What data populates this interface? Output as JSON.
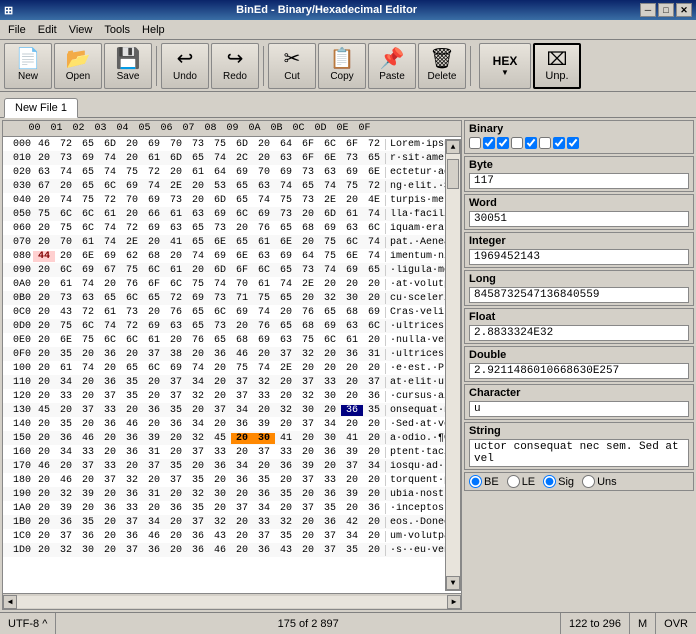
{
  "titlebar": {
    "title": "BinEd - Binary/Hexadecimal Editor",
    "icon": "⬛",
    "min_btn": "─",
    "max_btn": "□",
    "close_btn": "✕"
  },
  "menu": {
    "items": [
      "File",
      "Edit",
      "View",
      "Tools",
      "Help"
    ]
  },
  "toolbar": {
    "buttons": [
      {
        "id": "new",
        "label": "New",
        "icon": "📄"
      },
      {
        "id": "open",
        "label": "Open",
        "icon": "📂"
      },
      {
        "id": "save",
        "label": "Save",
        "icon": "💾"
      },
      {
        "id": "undo",
        "label": "Undo",
        "icon": "↩"
      },
      {
        "id": "redo",
        "label": "Redo",
        "icon": "↪"
      },
      {
        "id": "cut",
        "label": "Cut",
        "icon": "✂"
      },
      {
        "id": "copy",
        "label": "Copy",
        "icon": "📋"
      },
      {
        "id": "paste",
        "label": "Paste",
        "icon": "📌"
      },
      {
        "id": "delete",
        "label": "Delete",
        "icon": "🗑"
      }
    ],
    "hex_btn": "HEX",
    "unp_btn": "Unp."
  },
  "tab": {
    "label": "New File 1"
  },
  "hex_header": {
    "addr": "",
    "cols": [
      "00",
      "01",
      "02",
      "03",
      "04",
      "05",
      "06",
      "07",
      "08",
      "09",
      "0A",
      "0B",
      "0C",
      "0D",
      "0E",
      "0F"
    ]
  },
  "hex_rows": [
    {
      "addr": "000",
      "bytes": [
        "46",
        "72",
        "65",
        "6D",
        "20",
        "69",
        "70",
        "73",
        "75",
        "6D",
        "20",
        "64",
        "6F",
        "6C",
        "6F",
        "72"
      ],
      "text": "Lorem ipsum"
    },
    {
      "addr": "010",
      "bytes": [
        "20",
        "73",
        "69",
        "74",
        "20",
        "61",
        "6D",
        "65",
        "74",
        "2C",
        "20",
        "63",
        "6F",
        "6E",
        "73",
        "65"
      ],
      "text": "r·sit·amet,"
    },
    {
      "addr": "020",
      "bytes": [
        "63",
        "74",
        "65",
        "74",
        "75",
        "72",
        "20",
        "61",
        "64",
        "69",
        "70",
        "69",
        "73",
        "63",
        "69",
        "6E"
      ],
      "text": "ectetur·adi"
    },
    {
      "addr": "030",
      "bytes": [
        "67",
        "20",
        "65",
        "6C",
        "69",
        "74",
        "2E",
        "20",
        "53",
        "65",
        "63",
        "74",
        "65",
        "74",
        "75",
        "72"
      ],
      "text": "ng·elit.·Se"
    },
    {
      "addr": "040",
      "bytes": [
        "20",
        "74",
        "75",
        "72",
        "70",
        "69",
        "73",
        "20",
        "6D",
        "65",
        "74",
        "75",
        "73",
        "2E",
        "20",
        "4E"
      ],
      "text": "turpis·metu"
    },
    {
      "addr": "050",
      "bytes": [
        "75",
        "6C",
        "6C",
        "61",
        "20",
        "66",
        "61",
        "63",
        "69",
        "6C",
        "69",
        "73",
        "20",
        "6D",
        "61",
        "74"
      ],
      "text": "lla·facilis"
    },
    {
      "addr": "060",
      "bytes": [
        "20",
        "75",
        "6C",
        "74",
        "72",
        "69",
        "63",
        "65",
        "73",
        "20",
        "76",
        "65",
        "68",
        "69",
        "63",
        "6C"
      ],
      "text": "iquam·erat·"
    },
    {
      "addr": "070",
      "bytes": [
        "20",
        "70",
        "61",
        "74",
        "2E",
        "20",
        "41",
        "65",
        "6E",
        "65",
        "61",
        "6E",
        "20",
        "75",
        "6C",
        "74"
      ],
      "text": "pat.·Aenean"
    },
    {
      "addr": "080",
      "bytes": [
        "44",
        "20",
        "6E",
        "69",
        "62",
        "68",
        "20",
        "74",
        "69",
        "6E",
        "63",
        "69",
        "64",
        "75",
        "6E",
        "74"
      ],
      "text": "imentum·nib",
      "highlight": [
        0
      ]
    },
    {
      "addr": "090",
      "bytes": [
        "20",
        "6C",
        "69",
        "67",
        "75",
        "6C",
        "61",
        "20",
        "6D",
        "6F",
        "6C",
        "65",
        "73",
        "74",
        "69",
        "65"
      ],
      "text": "·ligula·mol"
    },
    {
      "addr": "0A0",
      "bytes": [
        "20",
        "61",
        "74",
        "20",
        "76",
        "6F",
        "6C",
        "75",
        "74",
        "70",
        "61",
        "74",
        "2E",
        "20",
        "20",
        "20"
      ],
      "text": "·at·volutpa"
    },
    {
      "addr": "0B0",
      "bytes": [
        "20",
        "73",
        "63",
        "65",
        "6C",
        "65",
        "72",
        "69",
        "73",
        "71",
        "75",
        "65",
        "20",
        "32",
        "30",
        "20"
      ],
      "text": "cu·sceleris"
    },
    {
      "addr": "0C0",
      "bytes": [
        "20",
        "43",
        "72",
        "61",
        "73",
        "20",
        "76",
        "65",
        "6C",
        "69",
        "74",
        "20",
        "76",
        "65",
        "68",
        "69"
      ],
      "text": "Cras·velit·"
    },
    {
      "addr": "0D0",
      "bytes": [
        "20",
        "75",
        "6C",
        "74",
        "72",
        "69",
        "63",
        "65",
        "73",
        "20",
        "76",
        "65",
        "68",
        "69",
        "63",
        "6C"
      ],
      "text": "·ultrices·y"
    },
    {
      "addr": "0E0",
      "bytes": [
        "20",
        "6E",
        "75",
        "6C",
        "6C",
        "61",
        "20",
        "76",
        "65",
        "68",
        "69",
        "63",
        "75",
        "6C",
        "61",
        "20"
      ],
      "text": "·nulla·vehi"
    },
    {
      "addr": "0F0",
      "bytes": [
        "20",
        "35",
        "20",
        "36",
        "20",
        "37",
        "38",
        "20",
        "36",
        "46",
        "20",
        "37",
        "32",
        "20",
        "36",
        "31"
      ],
      "text": "·ultrices·s"
    },
    {
      "addr": "100",
      "bytes": [
        "20",
        "61",
        "74",
        "20",
        "65",
        "6C",
        "69",
        "74",
        "20",
        "75",
        "74",
        "2E",
        "20",
        "20",
        "20",
        "20"
      ],
      "text": "·e·est.·Pra"
    },
    {
      "addr": "110",
      "bytes": [
        "20",
        "34",
        "20",
        "36",
        "35",
        "20",
        "37",
        "34",
        "20",
        "37",
        "32",
        "20",
        "37",
        "33",
        "20",
        "37"
      ],
      "text": "at·elit·ut·"
    },
    {
      "addr": "120",
      "bytes": [
        "20",
        "33",
        "20",
        "37",
        "35",
        "20",
        "37",
        "32",
        "20",
        "37",
        "33",
        "20",
        "32",
        "30",
        "20",
        "36"
      ],
      "text": "·cursus·aic"
    },
    {
      "addr": "130",
      "bytes": [
        "45",
        "20",
        "37",
        "33",
        "20",
        "36",
        "35",
        "20",
        "37",
        "34",
        "20",
        "32",
        "30",
        "20",
        "36",
        "35"
      ],
      "text": "onsequat·ne",
      "cursor": [
        14
      ]
    },
    {
      "addr": "140",
      "bytes": [
        "20",
        "35",
        "20",
        "36",
        "46",
        "20",
        "36",
        "34",
        "20",
        "36",
        "39",
        "20",
        "37",
        "34",
        "20",
        "20"
      ],
      "text": "·Sed·at·vel"
    },
    {
      "addr": "150",
      "bytes": [
        "20",
        "36",
        "46",
        "20",
        "36",
        "39",
        "20",
        "32",
        "45",
        "20",
        "30",
        "41",
        "20",
        "30",
        "41",
        "20"
      ],
      "text": "a·odio.·¶Cl",
      "highlight": [
        9,
        10
      ]
    },
    {
      "addr": "160",
      "bytes": [
        "20",
        "34",
        "33",
        "20",
        "36",
        "31",
        "20",
        "37",
        "33",
        "20",
        "37",
        "33",
        "20",
        "36",
        "39",
        "20"
      ],
      "text": "ptent·tacit"
    },
    {
      "addr": "170",
      "bytes": [
        "46",
        "20",
        "37",
        "33",
        "20",
        "37",
        "35",
        "20",
        "36",
        "34",
        "20",
        "36",
        "39",
        "20",
        "37",
        "34"
      ],
      "text": "iosqu·ad·li"
    },
    {
      "addr": "180",
      "bytes": [
        "20",
        "46",
        "20",
        "37",
        "32",
        "20",
        "37",
        "35",
        "20",
        "36",
        "35",
        "20",
        "37",
        "33",
        "20",
        "20"
      ],
      "text": "torquent·pe"
    },
    {
      "addr": "190",
      "bytes": [
        "20",
        "32",
        "39",
        "20",
        "36",
        "31",
        "20",
        "32",
        "30",
        "20",
        "36",
        "35",
        "20",
        "36",
        "39",
        "20"
      ],
      "text": "ubia·nostra"
    },
    {
      "addr": "1A0",
      "bytes": [
        "20",
        "39",
        "20",
        "36",
        "33",
        "20",
        "36",
        "35",
        "20",
        "37",
        "34",
        "20",
        "37",
        "35",
        "20",
        "36"
      ],
      "text": "·inceptos·h"
    },
    {
      "addr": "1B0",
      "bytes": [
        "20",
        "36",
        "35",
        "20",
        "37",
        "34",
        "20",
        "37",
        "32",
        "20",
        "33",
        "32",
        "20",
        "36",
        "42",
        "20"
      ],
      "text": "eos.·Donec·"
    },
    {
      "addr": "1C0",
      "bytes": [
        "20",
        "37",
        "36",
        "20",
        "36",
        "46",
        "20",
        "36",
        "43",
        "20",
        "37",
        "35",
        "20",
        "37",
        "34",
        "20"
      ],
      "text": "um·volutpat"
    },
    {
      "addr": "1D0",
      "bytes": [
        "20",
        "32",
        "30",
        "20",
        "37",
        "36",
        "20",
        "36",
        "46",
        "20",
        "36",
        "43",
        "20",
        "37",
        "35",
        "20"
      ],
      "text": "·s··eu·vene"
    }
  ],
  "right_panel": {
    "binary_label": "Binary",
    "binary_checks": [
      false,
      true,
      true,
      false,
      true,
      false,
      false,
      true,
      true,
      false
    ],
    "byte_label": "Byte",
    "byte_value": "117",
    "word_label": "Word",
    "word_value": "30051",
    "integer_label": "Integer",
    "integer_value": "1969452143",
    "long_label": "Long",
    "long_value": "8458732547136840559",
    "float_label": "Float",
    "float_value": "2.8833324E32",
    "double_label": "Double",
    "double_value": "2.9211486010668630E257",
    "character_label": "Character",
    "character_value": "u",
    "string_label": "String",
    "string_value": "uctor consequat nec sem. Sed at vel",
    "radio_be": "BE",
    "radio_le": "LE",
    "radio_sig": "Sig",
    "radio_uns": "Uns"
  },
  "statusbar": {
    "encoding": "UTF-8 ^",
    "position": "175 of 2 897",
    "range": "122 to 296",
    "mode": "M",
    "ovr": "OVR"
  }
}
